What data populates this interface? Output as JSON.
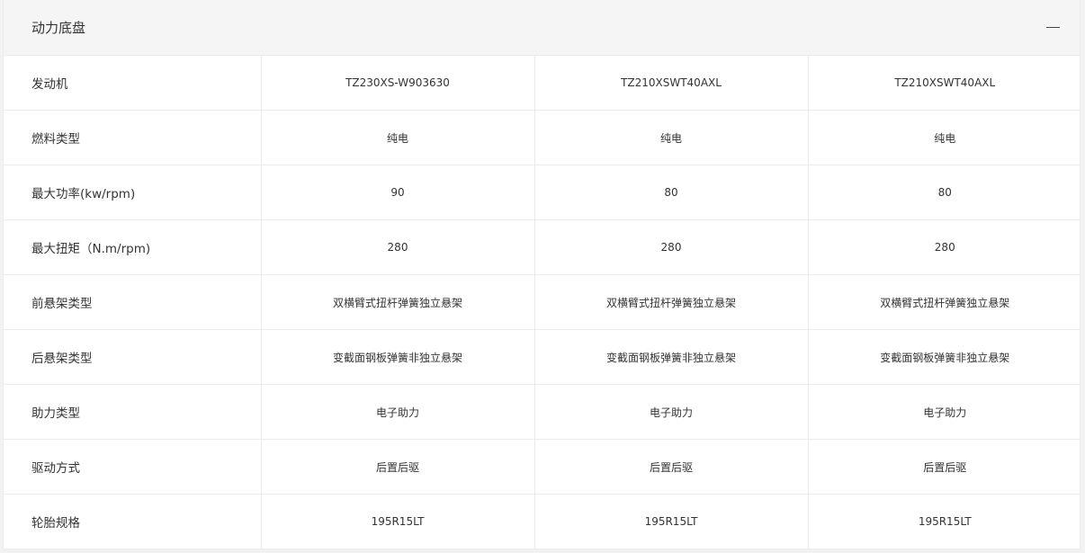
{
  "section": {
    "title": "动力底盘",
    "collapse_icon": "minus-icon"
  },
  "rows": [
    {
      "label": "发动机",
      "values": [
        "TZ230XS-W903630",
        "TZ210XSWT40AXL",
        "TZ210XSWT40AXL"
      ]
    },
    {
      "label": "燃料类型",
      "values": [
        "纯电",
        "纯电",
        "纯电"
      ]
    },
    {
      "label": "最大功率(kw/rpm)",
      "values": [
        "90",
        "80",
        "80"
      ]
    },
    {
      "label": "最大扭矩（N.m/rpm)",
      "values": [
        "280",
        "280",
        "280"
      ]
    },
    {
      "label": "前悬架类型",
      "values": [
        "双横臂式扭杆弹簧独立悬架",
        "双横臂式扭杆弹簧独立悬架",
        "双横臂式扭杆弹簧独立悬架"
      ]
    },
    {
      "label": "后悬架类型",
      "values": [
        "变截面钢板弹簧非独立悬架",
        "变截面钢板弹簧非独立悬架",
        "变截面钢板弹簧非独立悬架"
      ]
    },
    {
      "label": "助力类型",
      "values": [
        "电子助力",
        "电子助力",
        "电子助力"
      ]
    },
    {
      "label": "驱动方式",
      "values": [
        "后置后驱",
        "后置后驱",
        "后置后驱"
      ]
    },
    {
      "label": "轮胎规格",
      "values": [
        "195R15LT",
        "195R15LT",
        "195R15LT"
      ]
    }
  ]
}
